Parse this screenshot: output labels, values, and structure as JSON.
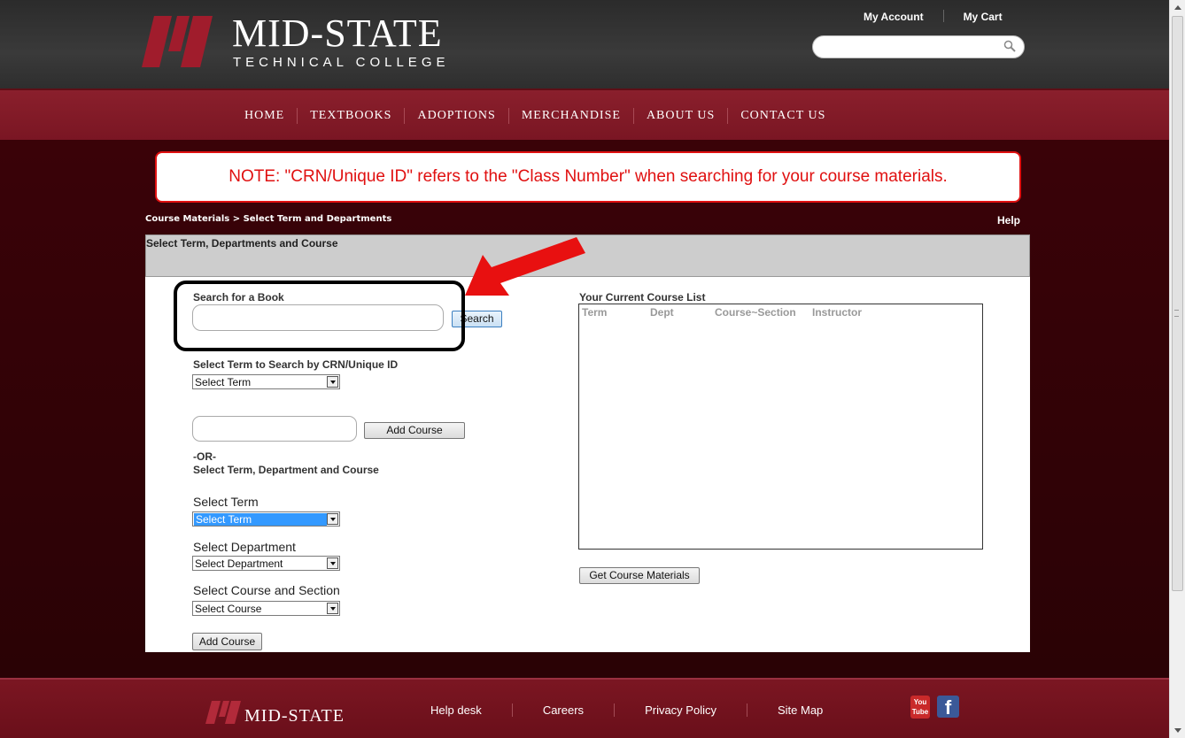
{
  "header": {
    "logo_title": "MID-STATE",
    "logo_subtitle": "TECHNICAL COLLEGE",
    "links": [
      "My Account",
      "My Cart"
    ],
    "search_value": ""
  },
  "nav": {
    "items": [
      "HOME",
      "TEXTBOOKS",
      "ADOPTIONS",
      "MERCHANDISE",
      "ABOUT US",
      "CONTACT US"
    ]
  },
  "note": "NOTE: \"CRN/Unique ID\" refers to the \"Class Number\" when searching for your course materials.",
  "breadcrumb": "Course Materials > Select Term and Departments",
  "help_label": "Help",
  "panel_title": "Select Term, Departments and Course",
  "search_book": {
    "label": "Search for a Book",
    "value": "",
    "button": "Search"
  },
  "crn": {
    "label": "Select Term to Search by CRN/Unique ID",
    "select_value": "Select Term",
    "input_value": "",
    "add_button": "Add Course"
  },
  "or_label": "-OR-",
  "term_dept_label": "Select Term, Department and Course",
  "term": {
    "label": "Select Term",
    "value": "Select Term"
  },
  "department": {
    "label": "Select Department",
    "value": "Select Department"
  },
  "course": {
    "label": "Select Course and Section",
    "value": "Select Course"
  },
  "add_course_button": "Add Course",
  "course_list": {
    "title": "Your Current Course List",
    "columns": [
      "Term",
      "Dept",
      "Course~Section",
      "Instructor"
    ]
  },
  "get_materials_button": "Get Course Materials",
  "footer": {
    "logo": "MID-STATE",
    "links": [
      "Help desk",
      "Careers",
      "Privacy Policy",
      "Site Map"
    ],
    "youtube_label": "You Tube",
    "facebook_label": "f"
  },
  "colors": {
    "brand_maroon": "#7a1623",
    "note_red": "#e01010",
    "annotation_arrow": "#e81010"
  }
}
